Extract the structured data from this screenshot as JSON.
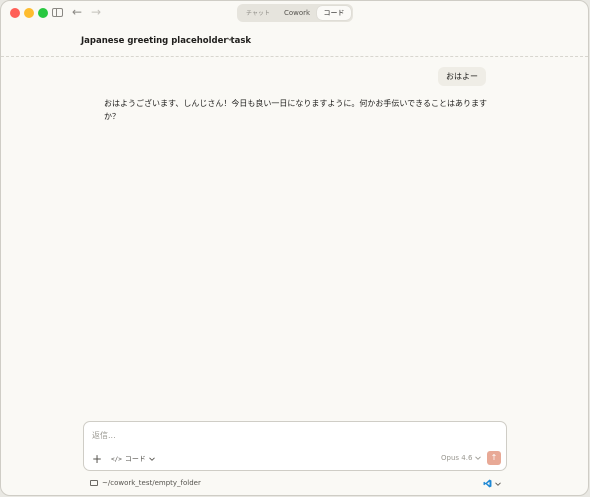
{
  "titlebar": {
    "mode_tabs": [
      {
        "label": "チャット"
      },
      {
        "label": "Cowork"
      },
      {
        "label": "コード"
      }
    ]
  },
  "header": {
    "task_title": "Japanese greeting placeholder task"
  },
  "conversation": {
    "user_message": "おはよー",
    "assistant_message": "おはようございます、しんじさん！今日も良い一日になりますように。何かお手伝いできることはありますか？"
  },
  "composer": {
    "placeholder": "返信...",
    "mode_label": "コード",
    "model_label": "Opus 4.6"
  },
  "footer": {
    "path": "~/cowork_test/empty_folder"
  },
  "colors": {
    "accent_send": "#e8a996",
    "background": "#faf9f5"
  }
}
